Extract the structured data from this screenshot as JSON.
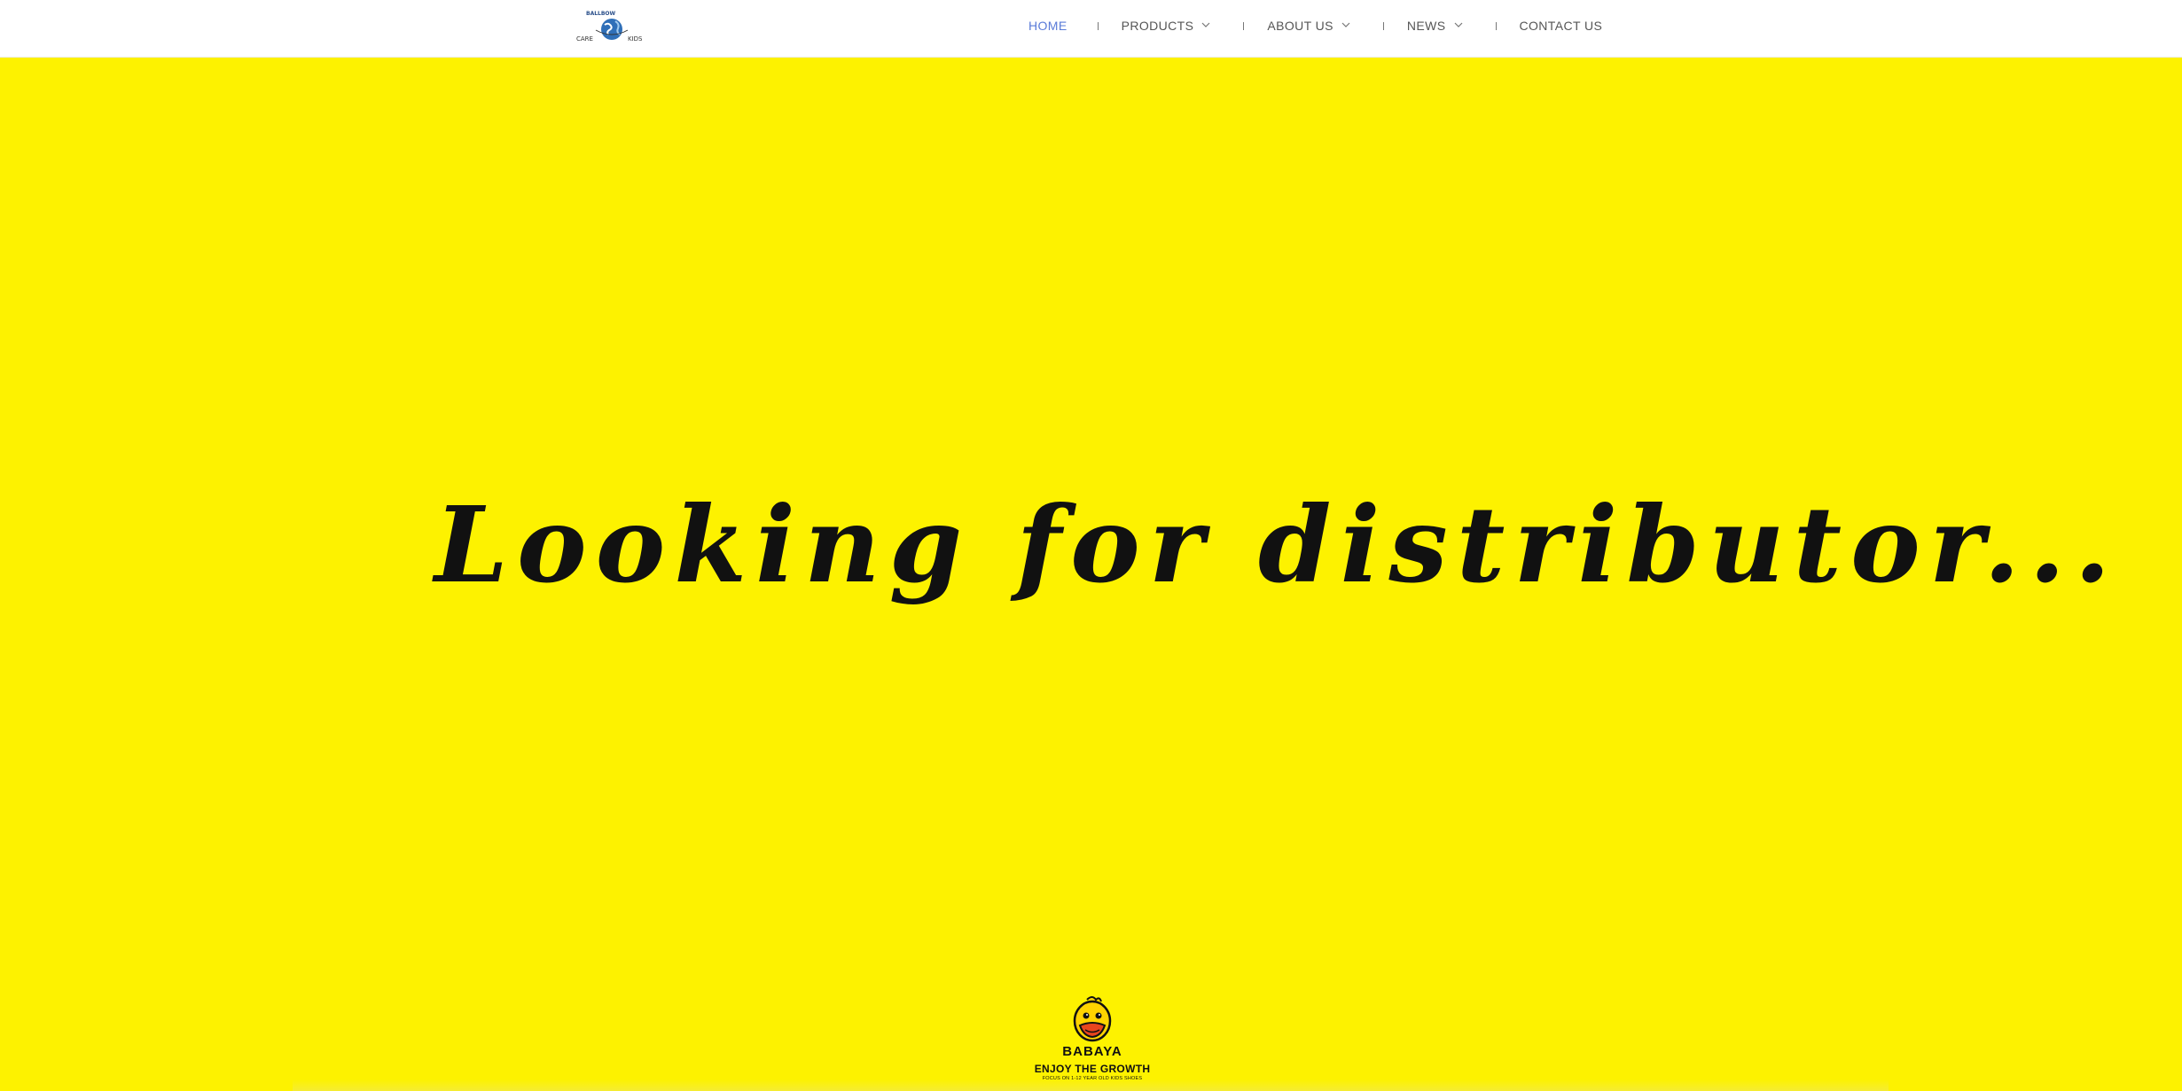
{
  "header": {
    "logo": {
      "icon": "globe-logo-icon",
      "lettering": "BALLBOW CARE KIDS"
    },
    "nav": [
      {
        "label": "HOME",
        "active": true,
        "has_dropdown": false
      },
      {
        "label": "PRODUCTS",
        "active": false,
        "has_dropdown": true
      },
      {
        "label": "ABOUT US",
        "active": false,
        "has_dropdown": true
      },
      {
        "label": "NEWS",
        "active": false,
        "has_dropdown": true
      },
      {
        "label": "CONTACT US",
        "active": false,
        "has_dropdown": false
      }
    ]
  },
  "hero": {
    "headline": "Looking for distributor..."
  },
  "brand": {
    "icon": "duck-mascot-icon",
    "name": "BABAYA",
    "slogan": "ENJOY THE GROWTH",
    "tagline": "FOCUS ON 1-12 YEAR OLD KIDS SHOES"
  },
  "colors": {
    "background": "#fdf200",
    "header_bg": "#ffffff",
    "nav_text": "#555555",
    "nav_active": "#5a7bd8",
    "headline": "#111111"
  }
}
